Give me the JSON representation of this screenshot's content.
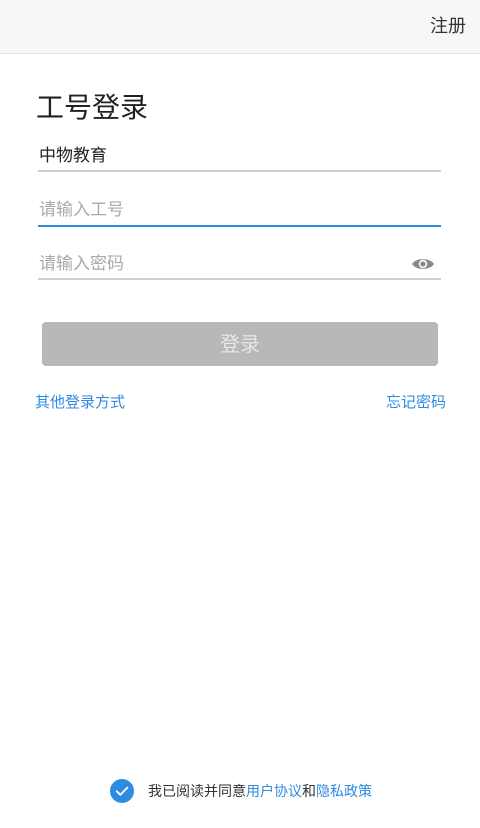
{
  "header": {
    "register_label": "注册"
  },
  "form": {
    "title": "工号登录",
    "org_value": "中物教育",
    "employee_id_placeholder": "请输入工号",
    "password_placeholder": "请输入密码",
    "login_label": "登录",
    "other_login_label": "其他登录方式",
    "forgot_password_label": "忘记密码"
  },
  "agreement": {
    "prefix": "我已阅读并同意",
    "user_agreement": "用户协议",
    "conjunction": "和",
    "privacy_policy": "隐私政策",
    "checked": true
  },
  "icons": {
    "password_toggle": "eye-icon",
    "agreement_check": "check-circle-icon"
  },
  "colors": {
    "accent": "#2d8be0",
    "button_disabled": "#b8b8b8"
  }
}
